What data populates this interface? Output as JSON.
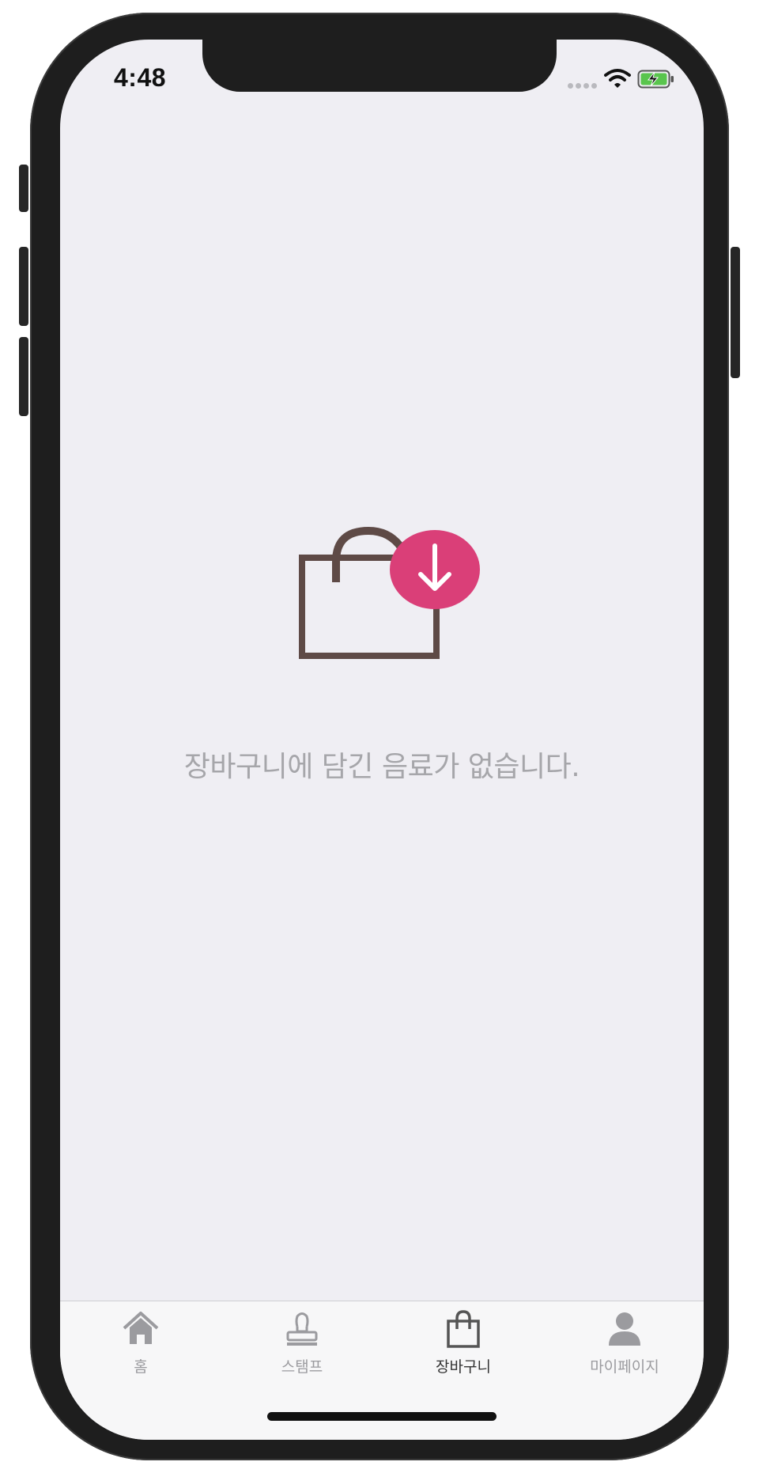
{
  "status_bar": {
    "time": "4:48",
    "icons": [
      "signal-dots",
      "wifi-icon",
      "battery-charging-icon"
    ]
  },
  "cart": {
    "empty_message": "장바구니에 담긴 음료가 없습니다.",
    "illustration": "shopping-bag-download-icon"
  },
  "tab_bar": {
    "tabs": [
      {
        "label": "홈",
        "icon": "home-icon",
        "active": false
      },
      {
        "label": "스탬프",
        "icon": "stamp-icon",
        "active": false
      },
      {
        "label": "장바구니",
        "icon": "shopping-bag-icon",
        "active": true
      },
      {
        "label": "마이페이지",
        "icon": "person-icon",
        "active": false
      }
    ]
  },
  "colors": {
    "background": "#efeef3",
    "bag_brown": "#5e4a46",
    "accent_pink": "#da3f78",
    "inactive_tab": "#9b9b9f",
    "active_tab": "#333333"
  }
}
